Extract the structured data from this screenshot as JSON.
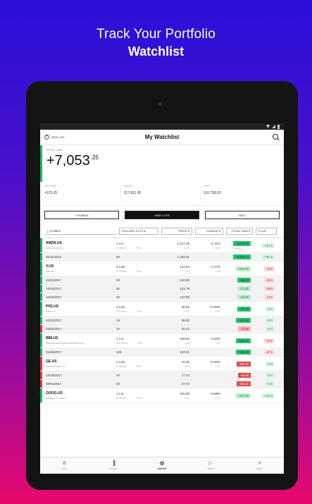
{
  "promo": {
    "line1": "Track Your Portfolio",
    "line2": "Watchlist"
  },
  "appbar": {
    "new_list": "NEW LIST",
    "title": "My Watchlist"
  },
  "summary": {
    "label": "TOTAL GAIN",
    "whole": "+7,053",
    "cents": ".25"
  },
  "stats": [
    {
      "label": "DAY GAIN",
      "value": "+973.35"
    },
    {
      "label": "VALUE",
      "value": "117,811.00"
    },
    {
      "label": "COST",
      "value": "110,758.03"
    }
  ],
  "actions": {
    "symbol": "+ SYMBOL",
    "hide_lots": "HIDE LOTS",
    "edit": "EDIT"
  },
  "columns": {
    "symbol": "△ SYMBOL",
    "lots": "DOLLARS LOTS ▾",
    "price": "PRICE ▾",
    "change": "CHANGE ▾",
    "total_gain": "TOTAL GAIN ▾",
    "day_gain": "D GAI"
  },
  "rows": [
    {
      "kind": "main",
      "trend": "pos",
      "symbol": "AMZN.US",
      "name": "Amazon.com Inc",
      "lots": "1 Lot",
      "lots_sub1": "50 Shares",
      "lots_sub2": "Price",
      "price": "1,417.68",
      "price_sub": "-10.00",
      "change": "+1.11%",
      "change_sub": "+15.60",
      "gain": "+3,875.98",
      "gain_sub": "+38.05%",
      "gain_style": "up",
      "day": "+781.5",
      "day_style": "pos"
    },
    {
      "kind": "lot",
      "trend": "pos",
      "date": "01/11/2012",
      "qty": "50",
      "cost": "1,284.91",
      "gain": "+6,638.73",
      "gain_style": "up",
      "day": "+781.5",
      "day_style": "pos"
    },
    {
      "kind": "main",
      "trend": "pos",
      "symbol": "V.US",
      "name": "Visa Inc",
      "lots": "3 Lots",
      "lots_sub1": "50 Shares",
      "lots_sub2": "Price",
      "price": "124.64",
      "price_sub": "+1.91",
      "change": "+1.17%",
      "change_sub": "+1.45",
      "gain": "+123.70",
      "gain_style": "lightup",
      "day": "-78.0",
      "day_style": "neg"
    },
    {
      "kind": "lot",
      "trend": "pos",
      "date": "11/21/2017",
      "qty": "20",
      "cost": "120.38",
      "gain": "+85.20",
      "gain_style": "up",
      "day": "-29.0",
      "day_style": "neg"
    },
    {
      "kind": "lot",
      "trend": "pos",
      "date": "12/03/2017",
      "qty": "20",
      "cost": "123.78",
      "gain": "+21.20",
      "gain_style": "lightup",
      "day": "-29.0",
      "day_style": "neg"
    },
    {
      "kind": "lot",
      "trend": "pos",
      "date": "12/16/2017",
      "qty": "10",
      "cost": "122.95",
      "gain": "+16.90",
      "gain_style": "lightup",
      "day": "-14.5",
      "day_style": "neg"
    },
    {
      "kind": "main",
      "trend": "pos",
      "symbol": "PFE.US",
      "name": "Pfizer Inc",
      "lots": "2 Lots",
      "lots_sub1": "25 Shares",
      "lots_sub2": "Price",
      "price": "36.02",
      "price_sub": "+0.00",
      "change": "+0.00%",
      "change_sub": "+0.00",
      "gain": "+47.40",
      "gain_style": "up",
      "day": "+0.0",
      "day_style": "pos"
    },
    {
      "kind": "lot",
      "trend": "pos",
      "date": "10/31/2017",
      "qty": "15",
      "cost": "35.00",
      "gain": "+109.40",
      "gain_style": "up",
      "day": "+0.0",
      "day_style": "pos"
    },
    {
      "kind": "lot",
      "trend": "neg",
      "date": "03/02/2017",
      "qty": "10",
      "cost": "40.22",
      "gain": "-12.00",
      "gain_style": "lightdown",
      "day": "+0.0",
      "day_style": "pos"
    },
    {
      "kind": "main",
      "trend": "pos",
      "symbol": "IBM.US",
      "name": "International Business Machines Corp",
      "lots": "1 Lot",
      "lots_sub1": "125 Shares",
      "lots_sub2": "Price",
      "price": "168.60",
      "price_sub": "-0.55",
      "change": "-0.32%",
      "change_sub": "-0.54",
      "gain": "+696.25",
      "gain_style": "up",
      "day": "-67.5",
      "day_style": "neg"
    },
    {
      "kind": "lot",
      "trend": "pos",
      "date": "01/26/2017",
      "qty": "125",
      "cost": "163.91",
      "gain": "+586.25",
      "gain_style": "up",
      "day": "-67.5",
      "day_style": "neg"
    },
    {
      "kind": "main",
      "trend": "neg",
      "symbol": "GE.US",
      "name": "General Electric Co",
      "lots": "2 Lots",
      "lots_sub1": "50 Shares",
      "lots_sub2": "Price",
      "price": "16.26",
      "price_sub": "+0.00",
      "change": "+0.00%",
      "change_sub": "+0.00",
      "gain": "-295.26",
      "gain_style": "down",
      "day": "+7.5",
      "day_style": "pos"
    },
    {
      "kind": "lot",
      "trend": "neg",
      "date": "12/20/2017",
      "qty": "20",
      "cost": "17.43",
      "gain": "-53.00",
      "gain_style": "down",
      "day": "+3.0",
      "day_style": "pos"
    },
    {
      "kind": "lot",
      "trend": "neg",
      "date": "03/01/2017",
      "qty": "30",
      "cost": "27.72",
      "gain": "-342.25",
      "gain_style": "down",
      "day": "+4.5",
      "day_style": "pos"
    },
    {
      "kind": "main",
      "trend": "pos",
      "symbol": "GOOG.US",
      "name": "Alphabet Inc Class C",
      "lots": "1 Lot",
      "lots_sub1": "50 Shares",
      "lots_sub2": "Price",
      "price": "220.68",
      "price_sub": "+0.00",
      "change": "+0.99%",
      "change_sub": "+2.21",
      "gain": "+127.00",
      "gain_style": "lightup",
      "day": "+155.6",
      "day_style": "pos"
    }
  ],
  "nav": [
    {
      "label": "Home",
      "glyph": "B",
      "active": false
    },
    {
      "label": "Sectors",
      "glyph": "▐",
      "active": false
    },
    {
      "label": "Watchlist",
      "glyph": "◎",
      "active": true
    },
    {
      "label": "Media",
      "glyph": "▷",
      "active": false
    },
    {
      "label": "Menu",
      "glyph": "≡",
      "active": false
    }
  ],
  "colors": {
    "gain_green": "#2ac36f",
    "loss_red": "#e34848",
    "background_top": "#2a10d8",
    "background_bottom": "#e60a6e"
  }
}
